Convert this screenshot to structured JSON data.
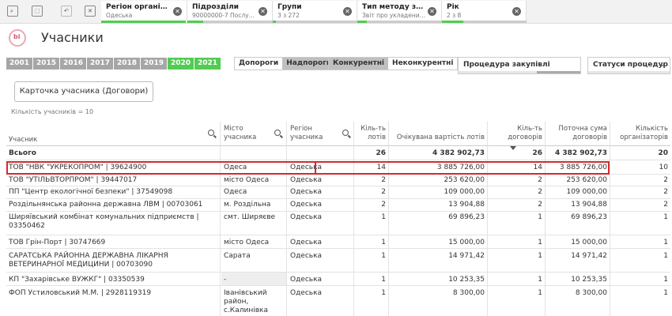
{
  "toolbar": {
    "chips": [
      {
        "title": "Регіон організа...",
        "sub": "Одеська"
      },
      {
        "title": "Підрозділи",
        "sub": "90000000-7 Послуг..."
      },
      {
        "title": "Групи",
        "sub": "3 з 272"
      },
      {
        "title": "Тип методу заку...",
        "sub": "Звіт про укладений ..."
      },
      {
        "title": "Рік",
        "sub": "2 з 8"
      }
    ]
  },
  "header": {
    "logo_text": "bi",
    "title": "Учасники"
  },
  "years": [
    "2001",
    "2015",
    "2016",
    "2017",
    "2018",
    "2019",
    "2020",
    "2021"
  ],
  "selected_years": [
    "2020",
    "2021"
  ],
  "threshold": {
    "option1": "Допороги",
    "option2": "Надпороги"
  },
  "competition": {
    "option1": "Конкурентні",
    "option2": "Неконкурентні"
  },
  "filters": {
    "procedure": "Процедура закупівлі",
    "status": "Статуси процедур"
  },
  "card_button": "Карточка учасника (Договори)",
  "participants_count": "Кількість учасників = 10",
  "columns": {
    "participant": "Учасник",
    "city": "Місто учасника",
    "region": "Регіон учасника",
    "lots": "Кіль-ть лотів",
    "expected": "Очікувана вартість лотів",
    "contracts": "Кіль-ть договорів",
    "current_sum": "Поточна сума договорів",
    "organizers": "Кількість організаторів"
  },
  "total": {
    "label": "Всього",
    "lots": "26",
    "expected": "4 382 902,73",
    "contracts": "26",
    "current_sum": "4 382 902,73",
    "organizers": "20"
  },
  "rows": [
    {
      "name": "ТОВ \"НВК \"УКРЕКОПРОМ\" | 39624900",
      "city": "Одеса",
      "region": "Одеська",
      "lots": "14",
      "expected": "3 885 726,00",
      "contracts": "14",
      "current_sum": "3 885 726,00",
      "organizers": "10"
    },
    {
      "name": "ТОВ \"УТІЛЬВТОРПРОМ\" | 39447017",
      "city": "місто Одеса",
      "region": "Одеська",
      "lots": "2",
      "expected": "253 620,00",
      "contracts": "2",
      "current_sum": "253 620,00",
      "organizers": "2"
    },
    {
      "name": "ПП \"Центр екологічної безпеки\" | 37549098",
      "city": "Одеса",
      "region": "Одеська",
      "lots": "2",
      "expected": "109 000,00",
      "contracts": "2",
      "current_sum": "109 000,00",
      "organizers": "2"
    },
    {
      "name": "Роздільнянська районна державна ЛВМ | 00703061",
      "city": "м. Роздільна",
      "region": "Одеська",
      "lots": "2",
      "expected": "13 904,88",
      "contracts": "2",
      "current_sum": "13 904,88",
      "organizers": "2"
    },
    {
      "name": "Ширяївський комбінат комунальних підприємств | 03350462",
      "city": "смт. Ширяєве",
      "region": "Одеська",
      "lots": "1",
      "expected": "69 896,23",
      "contracts": "1",
      "current_sum": "69 896,23",
      "organizers": "1"
    },
    {
      "name": "ТОВ Грін-Порт | 30747669",
      "city": "місто Одеса",
      "region": "Одеська",
      "lots": "1",
      "expected": "15 000,00",
      "contracts": "1",
      "current_sum": "15 000,00",
      "organizers": "1"
    },
    {
      "name": "САРАТСЬКА РАЙОННА ДЕРЖАВНА ЛІКАРНЯ ВЕТЕРИНАРНОЇ МЕДИЦИНИ | 00703090",
      "city": "Сарата",
      "region": "Одеська",
      "lots": "1",
      "expected": "14 971,42",
      "contracts": "1",
      "current_sum": "14 971,42",
      "organizers": "1"
    },
    {
      "name": "КП \"Захарівське ВУЖКГ\" | 03350539",
      "city": "-",
      "region": "Одеська",
      "lots": "1",
      "expected": "10 253,35",
      "contracts": "1",
      "current_sum": "10 253,35",
      "organizers": "1"
    },
    {
      "name": "ФОП Устиловський М.М. | 2928119319",
      "city": "Іванівський район, с.Калинівка",
      "region": "Одеська",
      "lots": "1",
      "expected": "8 300,00",
      "contracts": "1",
      "current_sum": "8 300,00",
      "organizers": "1"
    }
  ],
  "colors": {
    "accent_green": "#52cc52",
    "highlight_red": "#d42a2a",
    "year_grey": "#a6a6a6"
  }
}
